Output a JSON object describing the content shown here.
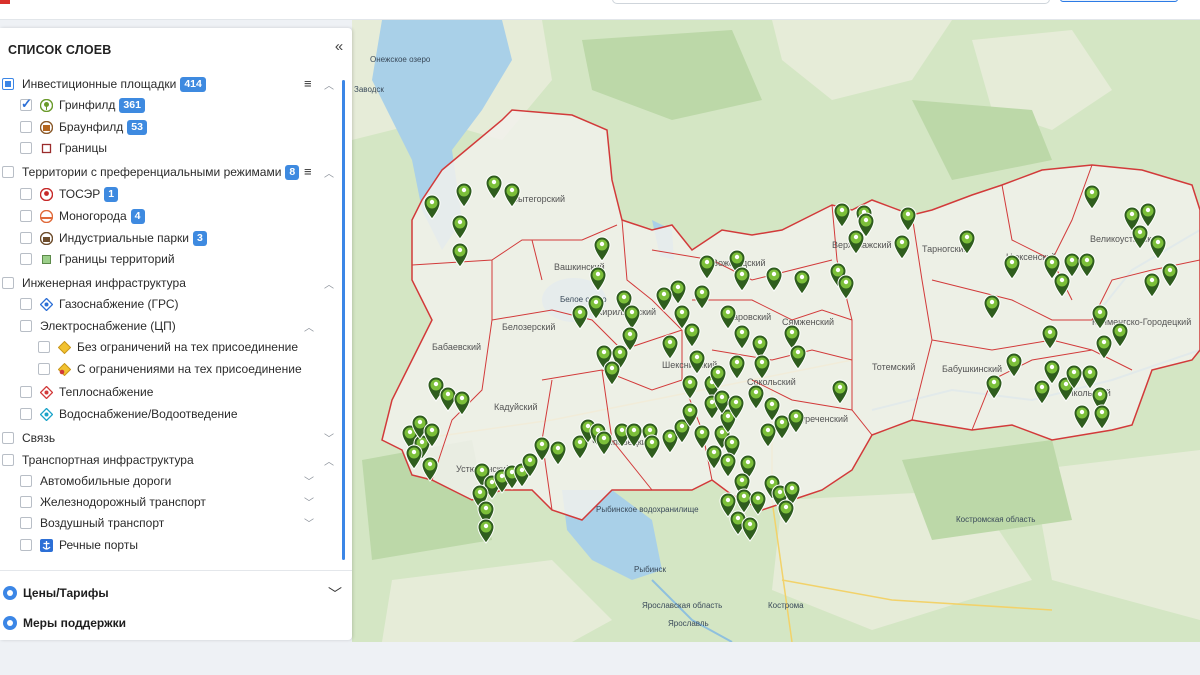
{
  "panel": {
    "title": "СПИСОК СЛОЕВ",
    "collapse_icon": "«",
    "groups": [
      {
        "label": "Инвестиционные площадки",
        "badge": "414",
        "state": "partial"
      },
      {
        "label": "Территории с преференциальными режимами",
        "badge": "8",
        "state": "unchecked"
      },
      {
        "label": "Инженерная инфраструктура",
        "state": "unchecked"
      },
      {
        "label": "Связь",
        "state": "unchecked"
      },
      {
        "label": "Транспортная инфраструктура",
        "state": "unchecked"
      }
    ],
    "items": {
      "greenfield": {
        "label": "Гринфилд",
        "badge": "361",
        "checked": true
      },
      "brownfield": {
        "label": "Браунфилд",
        "badge": "53",
        "checked": false
      },
      "borders": {
        "label": "Границы",
        "checked": false
      },
      "toser": {
        "label": "ТОСЭР",
        "badge": "1",
        "checked": false
      },
      "monotowns": {
        "label": "Моногорода",
        "badge": "4",
        "checked": false
      },
      "industrial_parks": {
        "label": "Индустриальные парки",
        "badge": "3",
        "checked": false
      },
      "territory_borders": {
        "label": "Границы территорий",
        "checked": false
      },
      "gas": {
        "label": "Газоснабжение (ГРС)",
        "checked": false
      },
      "electric": {
        "label": "Электроснабжение (ЦП)",
        "checked": false
      },
      "no_limits": {
        "label": "Без ограничений на тех присоединение",
        "checked": false
      },
      "with_limits": {
        "label": "С ограничениями на тех присоединение",
        "checked": false
      },
      "heat": {
        "label": "Теплоснабжение",
        "checked": false
      },
      "water": {
        "label": "Водоснабжение/Водоотведение",
        "checked": false
      },
      "roads": {
        "label": "Автомобильные дороги",
        "checked": false
      },
      "rail": {
        "label": "Железнодорожный транспорт",
        "checked": false
      },
      "air": {
        "label": "Воздушный транспорт",
        "checked": false
      },
      "ports": {
        "label": "Речные порты",
        "checked": false
      }
    },
    "sections": [
      {
        "label": "Цены/Тарифы",
        "icon": "tariff-icon"
      },
      {
        "label": "Меры поддержки",
        "icon": "support-icon"
      }
    ]
  },
  "map": {
    "district_labels": [
      "Вытегорский",
      "Вашкинский",
      "Белозерский",
      "Кирилловский",
      "Вожегодский",
      "Верховажский",
      "Тарногский",
      "Нюксенский",
      "Великоустюгский",
      "Бабаевский",
      "Кадуйский",
      "Череповецкий",
      "Устюженский",
      "Шекснинский",
      "Сокольский",
      "Междуреченский",
      "Тотемский",
      "Бабушкинский",
      "Кичменгско-Городецкий",
      "Никольский",
      "Харовский",
      "Сямженский"
    ],
    "place_labels": [
      "Онежское озеро",
      "Заводск",
      "Белое озеро",
      "Рыбинское водохранилище",
      "Рыбинск",
      "Ярославская область",
      "Ярославль",
      "Кострома",
      "Костромская область"
    ],
    "colors": {
      "land": "#d4e6c4",
      "water": "#a9d0e8",
      "region_fill": "#f2f2ee",
      "border": "#d23a3a",
      "marker": "#5c9e2e"
    }
  }
}
